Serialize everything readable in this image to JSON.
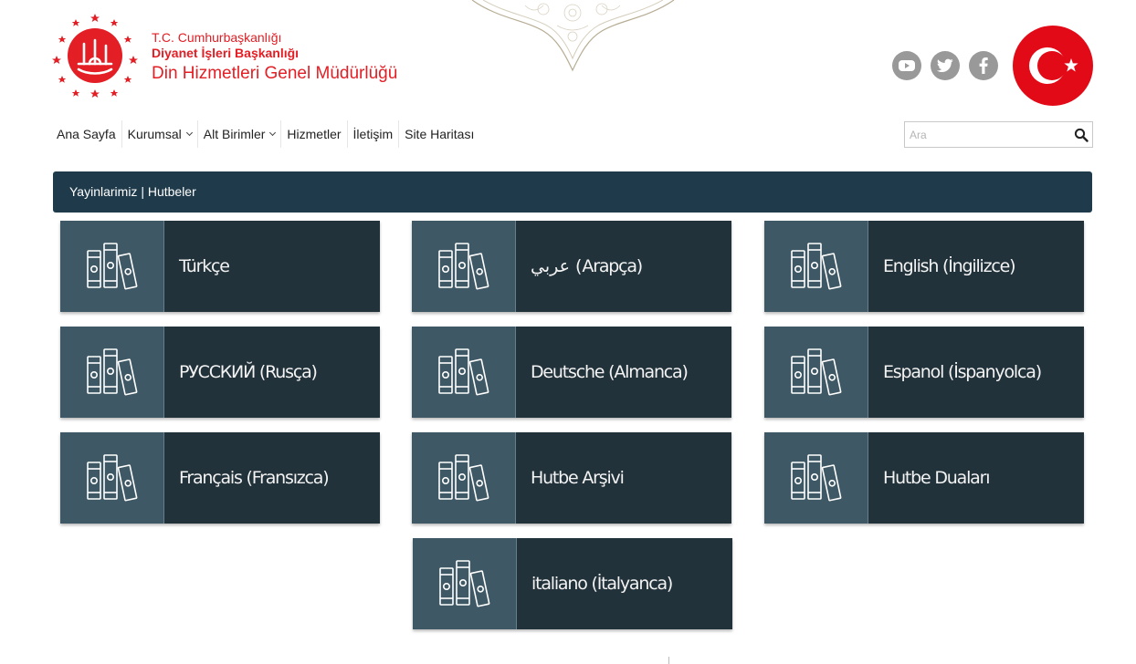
{
  "header": {
    "brand_line1": "T.C. Cumhurbaşkanlığı",
    "brand_line2": "Diyanet İşleri Başkanlığı",
    "brand_line3": "Din Hizmetleri Genel Müdürlüğü",
    "brand_color": "#e31e24"
  },
  "social": [
    {
      "name": "youtube",
      "icon": "youtube-icon"
    },
    {
      "name": "twitter",
      "icon": "twitter-icon"
    },
    {
      "name": "facebook",
      "icon": "facebook-icon"
    }
  ],
  "nav": {
    "items": [
      {
        "label": "Ana Sayfa",
        "dropdown": false
      },
      {
        "label": "Kurumsal",
        "dropdown": true
      },
      {
        "label": "Alt Birimler",
        "dropdown": true
      },
      {
        "label": "Hizmetler",
        "dropdown": false
      },
      {
        "label": "İletişim",
        "dropdown": false
      },
      {
        "label": "Site Haritası",
        "dropdown": false
      }
    ]
  },
  "search": {
    "placeholder": "Ara",
    "value": ""
  },
  "breadcrumb": {
    "text": "Yayinlarimiz | Hutbeler"
  },
  "cards": [
    {
      "label": "Türkçe",
      "icon": "books-icon"
    },
    {
      "label": "عربي (Arapça)",
      "icon": "books-icon"
    },
    {
      "label": "English (İngilizce)",
      "icon": "books-icon"
    },
    {
      "label": "РУССКИЙ (Rusça)",
      "icon": "books-icon"
    },
    {
      "label": "Deutsche (Almanca)",
      "icon": "books-icon"
    },
    {
      "label": "Espanol (İspanyolca)",
      "icon": "books-icon"
    },
    {
      "label": "Français (Fransızca)",
      "icon": "books-icon"
    },
    {
      "label": "Hutbe Arşivi",
      "icon": "books-icon"
    },
    {
      "label": "Hutbe Duaları",
      "icon": "books-icon"
    },
    {
      "label": "italiano (İtalyanca)",
      "icon": "books-icon"
    }
  ],
  "colors": {
    "card_icon_bg": "#3f5865",
    "card_label_bg": "#22323a",
    "breadcrumb_bg": "#1f3a4a",
    "social_bg": "#999999",
    "flag_red": "#e30a17"
  }
}
